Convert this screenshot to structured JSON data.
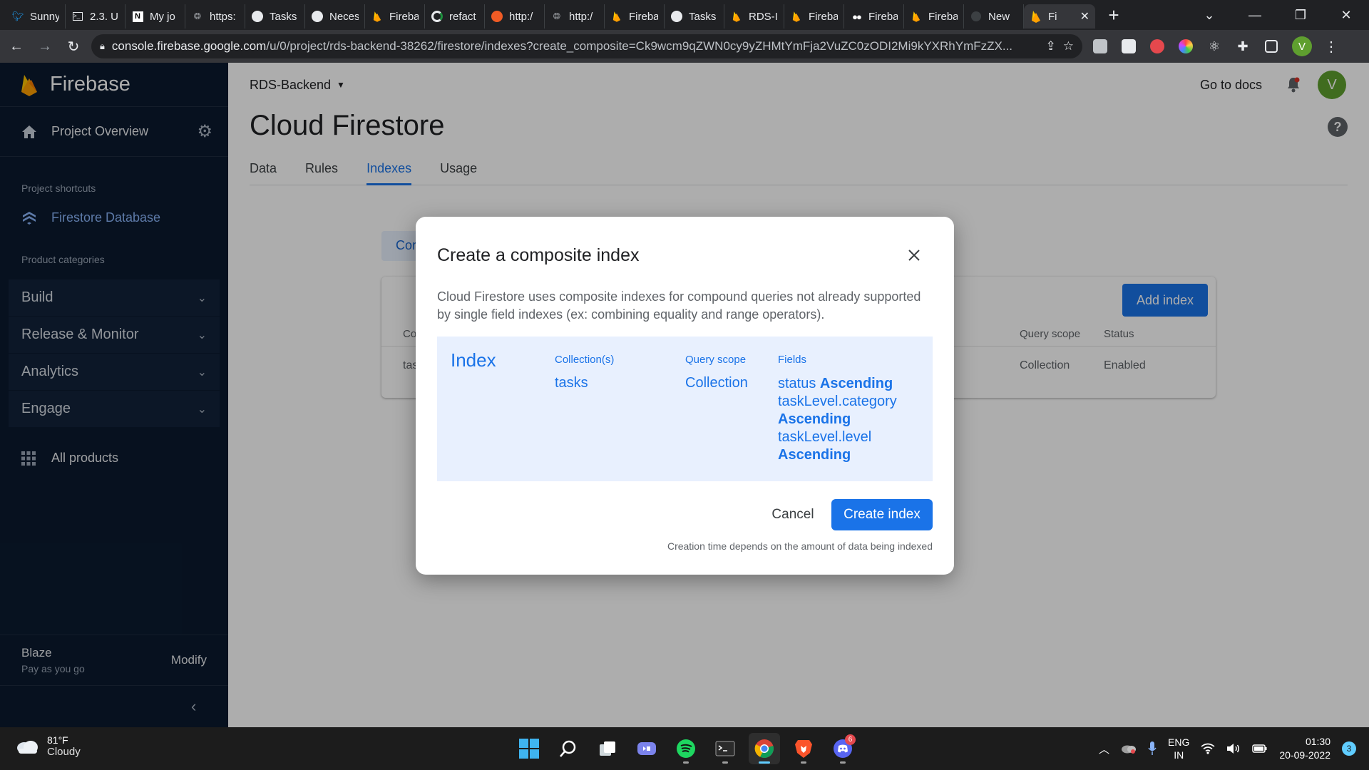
{
  "browser": {
    "tabs": [
      {
        "title": "Sunny",
        "icon": "twitter-icon"
      },
      {
        "title": "2.3. U",
        "icon": "terminal-icon"
      },
      {
        "title": "My jo",
        "icon": "notion-icon"
      },
      {
        "title": "https:",
        "icon": "globe-icon"
      },
      {
        "title": "Tasks",
        "icon": "github-icon"
      },
      {
        "title": "Neces",
        "icon": "github-icon"
      },
      {
        "title": "Fireba",
        "icon": "firebase-icon"
      },
      {
        "title": "refact",
        "icon": "github-refresh-icon"
      },
      {
        "title": "http:/",
        "icon": "postman-icon"
      },
      {
        "title": "http:/",
        "icon": "globe-icon"
      },
      {
        "title": "Fireba",
        "icon": "firebase-icon"
      },
      {
        "title": "Tasks",
        "icon": "github-icon"
      },
      {
        "title": "RDS-I",
        "icon": "firebase-icon"
      },
      {
        "title": "Fireba",
        "icon": "firebase-icon"
      },
      {
        "title": "Fireba",
        "icon": "medium-icon"
      },
      {
        "title": "Fireba",
        "icon": "firebase-icon"
      },
      {
        "title": "New",
        "icon": "blank-icon"
      }
    ],
    "active_tab": {
      "title": "Fi",
      "icon": "firebase-icon"
    },
    "url_host": "console.firebase.google.com",
    "url_path": "/u/0/project/rds-backend-38262/firestore/indexes?create_composite=Ck9wcm9qZWN0cy9yZHMtYmFja2VuZC0zODI2Mi9kYXRhYmFzZX..."
  },
  "sidebar": {
    "brand": "Firebase",
    "project_overview": "Project Overview",
    "shortcuts_label": "Project shortcuts",
    "shortcut_firestore": "Firestore Database",
    "categories_label": "Product categories",
    "categories": [
      "Build",
      "Release & Monitor",
      "Analytics",
      "Engage"
    ],
    "all_products": "All products",
    "plan_name": "Blaze",
    "plan_desc": "Pay as you go",
    "modify": "Modify"
  },
  "header": {
    "project": "RDS-Backend",
    "docs": "Go to docs",
    "avatar_letter": "V"
  },
  "page": {
    "title": "Cloud Firestore",
    "tabs": [
      "Data",
      "Rules",
      "Indexes",
      "Usage"
    ],
    "active_tab": "Indexes",
    "chip_label": "Cor",
    "add_index": "Add index",
    "table_headers": {
      "col1": "Co",
      "query_scope": "Query scope",
      "status": "Status"
    },
    "row": {
      "col1": "tas",
      "query_scope": "Collection",
      "status": "Enabled"
    }
  },
  "dialog": {
    "title": "Create a composite index",
    "description": "Cloud Firestore uses composite indexes for compound queries not already supported by single field indexes (ex: combining equality and range operators).",
    "index_label": "Index",
    "headers": {
      "collections": "Collection(s)",
      "query_scope": "Query scope",
      "fields": "Fields"
    },
    "collection": "tasks",
    "query_scope": "Collection",
    "fields": [
      {
        "name": "status",
        "order": "Ascending"
      },
      {
        "name": "taskLevel.category",
        "order": "Ascending"
      },
      {
        "name": "taskLevel.level",
        "order": "Ascending"
      }
    ],
    "cancel": "Cancel",
    "create": "Create index",
    "note": "Creation time depends on the amount of data being indexed"
  },
  "taskbar": {
    "temperature": "81°F",
    "condition": "Cloudy",
    "discord_badge": "6",
    "lang_line1": "ENG",
    "lang_line2": "IN",
    "time": "01:30",
    "date": "20-09-2022",
    "notification_count": "3"
  },
  "colors": {
    "accent": "#1a73e8",
    "sidebar_bg": "#0b1a2f",
    "firebase_orange": "#ffa000"
  }
}
